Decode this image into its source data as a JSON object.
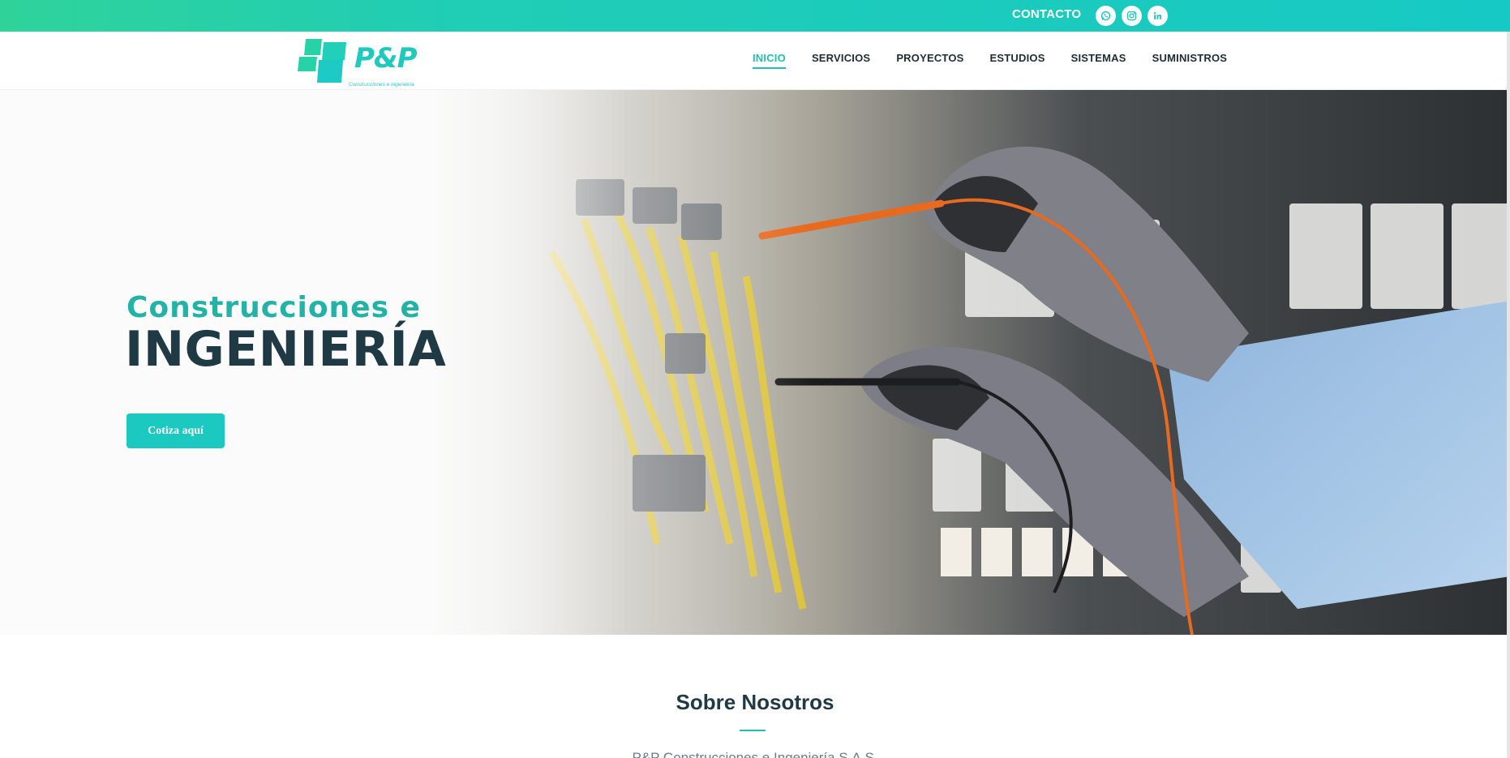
{
  "topbar": {
    "contact_label": "CONTACTO",
    "social": [
      {
        "name": "whatsapp-icon"
      },
      {
        "name": "instagram-icon"
      },
      {
        "name": "linkedin-icon"
      }
    ]
  },
  "logo": {
    "brand": "P&P",
    "tagline": "Construcciones e ingeniería"
  },
  "nav": {
    "items": [
      "INICIO",
      "SERVICIOS",
      "PROYECTOS",
      "ESTUDIOS",
      "SISTEMAS",
      "SUMINISTROS"
    ],
    "active": "INICIO"
  },
  "hero": {
    "subtitle": "Construcciones e",
    "title": "INGENIERÍA",
    "cta": "Cotiza aquí"
  },
  "about": {
    "title": "Sobre Nosotros",
    "text": "P&P Construcciones e Ingeniería S.A.S."
  },
  "colors": {
    "accent": "#1cc9c0",
    "dark": "#1f3a44",
    "topbar_start": "#2fd39a",
    "topbar_end": "#16c9c4"
  }
}
